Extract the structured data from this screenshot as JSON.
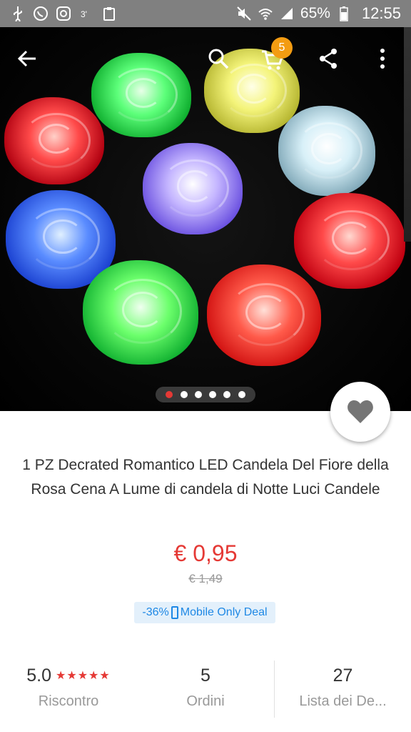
{
  "status_bar": {
    "notif_icons": [
      "usb-icon",
      "whatsapp-icon",
      "instagram-icon",
      "signal-3g-icon",
      "clipboard-icon"
    ],
    "battery": "65%",
    "time": "12:55"
  },
  "toolbar": {
    "back_icon": "arrow-back-icon",
    "search_icon": "search-icon",
    "cart_icon": "cart-icon",
    "cart_count": "5",
    "share_icon": "share-icon",
    "menu_icon": "more-vertical-icon"
  },
  "gallery": {
    "image_count": 6,
    "active_index": 0
  },
  "product": {
    "title": "1 PZ Decrated Romantico LED Candela Del Fiore della Rosa Cena A Lume di candela di Notte Luci Candele",
    "price": "€ 0,95",
    "old_price": "€ 1,49",
    "discount": "-36%",
    "deal_label": "Mobile Only Deal"
  },
  "stats": {
    "rating": {
      "value": "5.0",
      "stars": "★★★★★",
      "label": "Riscontro"
    },
    "orders": {
      "value": "5",
      "label": "Ordini"
    },
    "wishlist": {
      "value": "27",
      "label": "Lista dei De..."
    }
  },
  "colors": {
    "accent_red": "#e53935",
    "cart_badge": "#f39c12",
    "deal_blue": "#1e88e5",
    "status_bar": "#808080"
  }
}
